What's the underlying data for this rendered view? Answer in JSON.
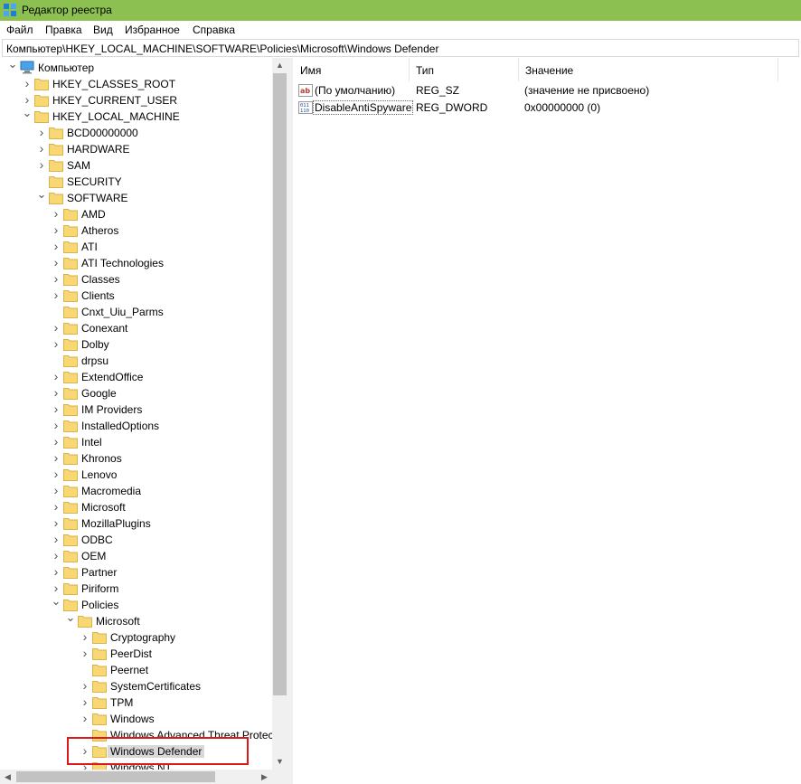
{
  "window": {
    "title": "Редактор реестра"
  },
  "menu": [
    "Файл",
    "Правка",
    "Вид",
    "Избранное",
    "Справка"
  ],
  "address": "Компьютер\\HKEY_LOCAL_MACHINE\\SOFTWARE\\Policies\\Microsoft\\Windows Defender",
  "tree": [
    {
      "label": "Компьютер",
      "level": 0,
      "exp": "open",
      "icon": "computer-icon"
    },
    {
      "label": "HKEY_CLASSES_ROOT",
      "level": 1,
      "exp": "closed"
    },
    {
      "label": "HKEY_CURRENT_USER",
      "level": 1,
      "exp": "closed"
    },
    {
      "label": "HKEY_LOCAL_MACHINE",
      "level": 1,
      "exp": "open"
    },
    {
      "label": "BCD00000000",
      "level": 2,
      "exp": "closed"
    },
    {
      "label": "HARDWARE",
      "level": 2,
      "exp": "closed"
    },
    {
      "label": "SAM",
      "level": 2,
      "exp": "closed"
    },
    {
      "label": "SECURITY",
      "level": 2,
      "exp": "none"
    },
    {
      "label": "SOFTWARE",
      "level": 2,
      "exp": "open"
    },
    {
      "label": "AMD",
      "level": 3,
      "exp": "closed"
    },
    {
      "label": "Atheros",
      "level": 3,
      "exp": "closed"
    },
    {
      "label": "ATI",
      "level": 3,
      "exp": "closed"
    },
    {
      "label": "ATI Technologies",
      "level": 3,
      "exp": "closed"
    },
    {
      "label": "Classes",
      "level": 3,
      "exp": "closed"
    },
    {
      "label": "Clients",
      "level": 3,
      "exp": "closed"
    },
    {
      "label": "Cnxt_Uiu_Parms",
      "level": 3,
      "exp": "none"
    },
    {
      "label": "Conexant",
      "level": 3,
      "exp": "closed"
    },
    {
      "label": "Dolby",
      "level": 3,
      "exp": "closed"
    },
    {
      "label": "drpsu",
      "level": 3,
      "exp": "none"
    },
    {
      "label": "ExtendOffice",
      "level": 3,
      "exp": "closed"
    },
    {
      "label": "Google",
      "level": 3,
      "exp": "closed"
    },
    {
      "label": "IM Providers",
      "level": 3,
      "exp": "closed"
    },
    {
      "label": "InstalledOptions",
      "level": 3,
      "exp": "closed"
    },
    {
      "label": "Intel",
      "level": 3,
      "exp": "closed"
    },
    {
      "label": "Khronos",
      "level": 3,
      "exp": "closed"
    },
    {
      "label": "Lenovo",
      "level": 3,
      "exp": "closed"
    },
    {
      "label": "Macromedia",
      "level": 3,
      "exp": "closed"
    },
    {
      "label": "Microsoft",
      "level": 3,
      "exp": "closed"
    },
    {
      "label": "MozillaPlugins",
      "level": 3,
      "exp": "closed"
    },
    {
      "label": "ODBC",
      "level": 3,
      "exp": "closed"
    },
    {
      "label": "OEM",
      "level": 3,
      "exp": "closed"
    },
    {
      "label": "Partner",
      "level": 3,
      "exp": "closed"
    },
    {
      "label": "Piriform",
      "level": 3,
      "exp": "closed"
    },
    {
      "label": "Policies",
      "level": 3,
      "exp": "open"
    },
    {
      "label": "Microsoft",
      "level": 4,
      "exp": "open"
    },
    {
      "label": "Cryptography",
      "level": 5,
      "exp": "closed"
    },
    {
      "label": "PeerDist",
      "level": 5,
      "exp": "closed"
    },
    {
      "label": "Peernet",
      "level": 5,
      "exp": "none"
    },
    {
      "label": "SystemCertificates",
      "level": 5,
      "exp": "closed"
    },
    {
      "label": "TPM",
      "level": 5,
      "exp": "closed"
    },
    {
      "label": "Windows",
      "level": 5,
      "exp": "closed"
    },
    {
      "label": "Windows Advanced Threat Protec",
      "level": 5,
      "exp": "none"
    },
    {
      "label": "Windows Defender",
      "level": 5,
      "exp": "closed",
      "selected": true
    },
    {
      "label": "Windows NT",
      "level": 5,
      "exp": "closed"
    }
  ],
  "columns": {
    "name": "Имя",
    "type": "Тип",
    "value": "Значение"
  },
  "values": [
    {
      "name": "(По умолчанию)",
      "type": "REG_SZ",
      "value": "(значение не присвоено)",
      "icon": "string-value-icon"
    },
    {
      "name": "DisableAntiSpyware",
      "type": "REG_DWORD",
      "value": "0x00000000 (0)",
      "icon": "binary-value-icon",
      "focus": true
    }
  ],
  "colors": {
    "titlebar": "#8cc152",
    "folder": "#f8d775",
    "highlight": "#d9191c"
  }
}
